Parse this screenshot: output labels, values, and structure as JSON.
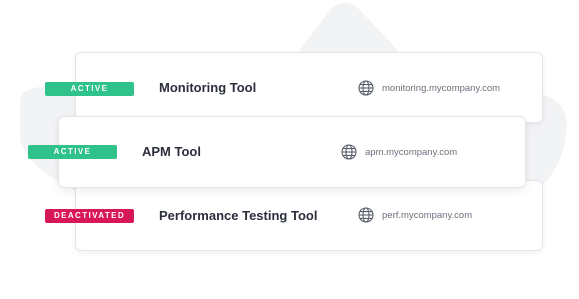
{
  "colors": {
    "active": "#2fc28b",
    "deactivated": "#d8175a",
    "card_border": "#e3e5ea",
    "background_shape": "#f2f3f5"
  },
  "tools": [
    {
      "status": "ACTIVE",
      "name": "Monitoring Tool",
      "url": "monitoring.mycompany.com",
      "icon": "globe-icon"
    },
    {
      "status": "ACTIVE",
      "name": "APM Tool",
      "url": "apm.mycompany.com",
      "icon": "globe-icon"
    },
    {
      "status": "DEACTIVATED",
      "name": "Performance Testing Tool",
      "url": "perf.mycompany.com",
      "icon": "globe-icon"
    }
  ]
}
